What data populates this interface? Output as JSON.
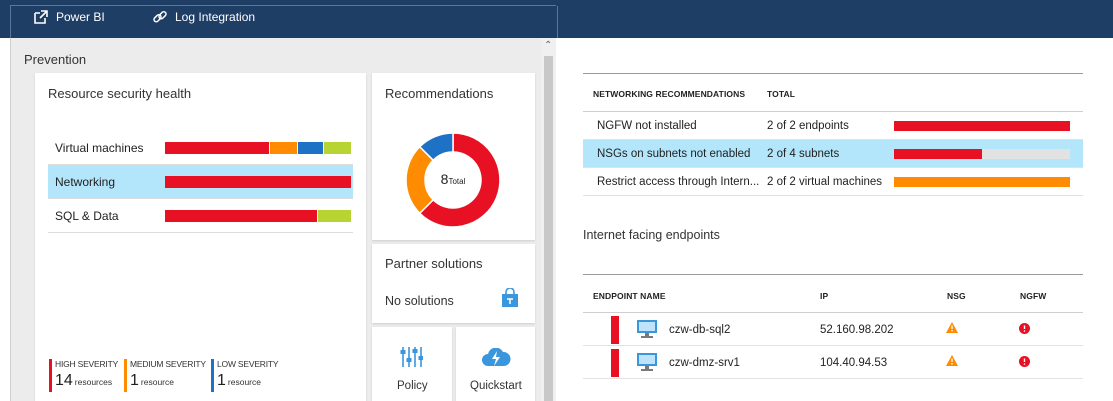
{
  "toolbar": {
    "power_bi_label": "Power BI",
    "log_integration_label": "Log Integration"
  },
  "prevention": {
    "title": "Prevention",
    "resource_health": {
      "title": "Resource security health",
      "rows": [
        {
          "label": "Virtual machines",
          "segments": [
            {
              "severity": "high",
              "fraction": 0.56
            },
            {
              "severity": "medium",
              "fraction": 0.15
            },
            {
              "severity": "low",
              "fraction": 0.14
            },
            {
              "severity": "healthy",
              "fraction": 0.15
            }
          ]
        },
        {
          "label": "Networking",
          "segments": [
            {
              "severity": "high",
              "fraction": 1.0
            }
          ]
        },
        {
          "label": "SQL & Data",
          "segments": [
            {
              "severity": "high",
              "fraction": 0.82
            },
            {
              "severity": "healthy",
              "fraction": 0.18
            }
          ]
        }
      ],
      "legend": [
        {
          "label": "HIGH SEVERITY",
          "count": "14",
          "unit": "resources",
          "color": "#e81123"
        },
        {
          "label": "MEDIUM SEVERITY",
          "count": "1",
          "unit": "resource",
          "color": "#ff8c00"
        },
        {
          "label": "LOW SEVERITY",
          "count": "1",
          "unit": "resource",
          "color": "#1e72c6"
        }
      ]
    },
    "recommendations": {
      "title": "Recommendations",
      "total": "8",
      "total_label": "Total",
      "slices": [
        {
          "severity": "high",
          "value": 5,
          "color": "#e81123"
        },
        {
          "severity": "medium",
          "value": 2,
          "color": "#ff8c00"
        },
        {
          "severity": "low",
          "value": 1,
          "color": "#1e72c6"
        }
      ]
    },
    "partner_solutions": {
      "title": "Partner solutions",
      "status": "No solutions"
    },
    "policy_label": "Policy",
    "quickstart_label": "Quickstart"
  },
  "networking": {
    "col_recommendations": "NETWORKING RECOMMENDATIONS",
    "col_total": "TOTAL",
    "rows": [
      {
        "name": "NGFW not installed",
        "total": "2 of 2 endpoints",
        "fraction": 1.0,
        "color": "#e81123"
      },
      {
        "name": "NSGs on subnets not enabled",
        "total": "2 of 4 subnets",
        "fraction": 0.5,
        "color": "#e81123"
      },
      {
        "name": "Restrict access through Intern...",
        "total": "2 of 2 virtual machines",
        "fraction": 1.0,
        "color": "#ff8c00"
      }
    ]
  },
  "endpoints": {
    "title": "Internet facing endpoints",
    "col_name": "ENDPOINT NAME",
    "col_ip": "IP",
    "col_nsg": "NSG",
    "col_ngfw": "NGFW",
    "rows": [
      {
        "name": "czw-db-sql2",
        "ip": "52.160.98.202",
        "nsg": "warning",
        "ngfw": "error"
      },
      {
        "name": "czw-dmz-srv1",
        "ip": "104.40.94.53",
        "nsg": "warning",
        "ngfw": "error"
      }
    ]
  },
  "colors": {
    "high": "#e81123",
    "medium": "#ff8c00",
    "low": "#1e72c6",
    "healthy": "#b8d432",
    "selected_row": "#b3e5fb",
    "header_bar": "#1e3e66"
  }
}
